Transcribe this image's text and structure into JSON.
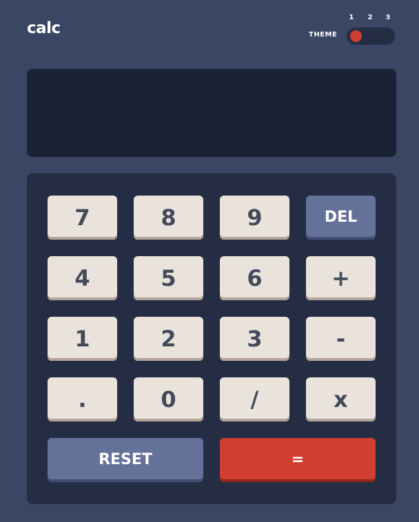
{
  "header": {
    "logo": "calc",
    "theme_label": "THEME",
    "theme_options": [
      "1",
      "2",
      "3"
    ],
    "active_theme": "1"
  },
  "display": {
    "value": ""
  },
  "keys": {
    "k7": "7",
    "k8": "8",
    "k9": "9",
    "del": "DEL",
    "k4": "4",
    "k5": "5",
    "k6": "6",
    "plus": "+",
    "k1": "1",
    "k2": "2",
    "k3": "3",
    "minus": "-",
    "dot": ".",
    "k0": "0",
    "divide": "/",
    "multiply": "x",
    "reset": "RESET",
    "equals": "="
  },
  "colors": {
    "main_background": "#3b4664",
    "keypad_background": "#252d44",
    "screen_background": "#1b2236",
    "key_background": "#eae3dc",
    "key_text": "#434a59",
    "key_alt_background": "#647198",
    "key_accent": "#d03f2f"
  }
}
